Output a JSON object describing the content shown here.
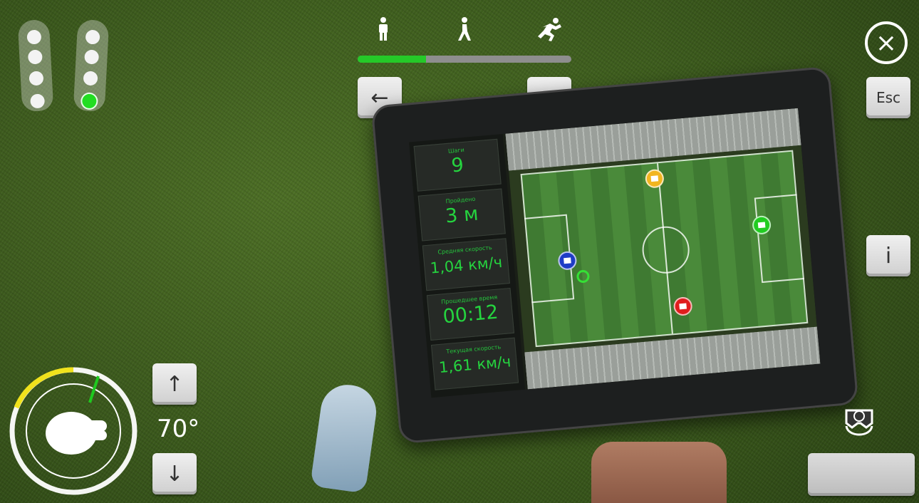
{
  "gait_levels": {
    "icons": [
      "standing-figure-icon",
      "walking-figure-icon",
      "running-figure-icon"
    ],
    "progress_percent": 32
  },
  "nav": {
    "prev_label": "←",
    "next_label": "→"
  },
  "controls": {
    "esc_label": "Esc",
    "info_label": "i",
    "up_label": "↑",
    "down_label": "↓",
    "angle": "70°",
    "close_symbol": "×"
  },
  "tablet": {
    "stats": [
      {
        "label": "Шаги",
        "value": "9"
      },
      {
        "label": "Пройдено",
        "value": "3 м"
      },
      {
        "label": "Средняя скорость",
        "value": "1,04 км/ч"
      },
      {
        "label": "Прошедшее время",
        "value": "00:12"
      },
      {
        "label": "Текущая скорость",
        "value": "1,61 км/ч"
      }
    ],
    "markers": [
      {
        "name": "yellow-flag-marker",
        "color": "#f2b51f"
      },
      {
        "name": "green-flag-marker",
        "color": "#21cc21"
      },
      {
        "name": "blue-flag-marker",
        "color": "#1e3cc6"
      },
      {
        "name": "red-flag-marker",
        "color": "#e01d1d"
      }
    ]
  },
  "footprints": {
    "left_dots": 4,
    "right_dots": 4,
    "active": "right-foot-dot-4"
  },
  "colors": {
    "accent": "#25c928",
    "stat_text": "#25d43f",
    "compass_arc": "#f0e21c"
  }
}
